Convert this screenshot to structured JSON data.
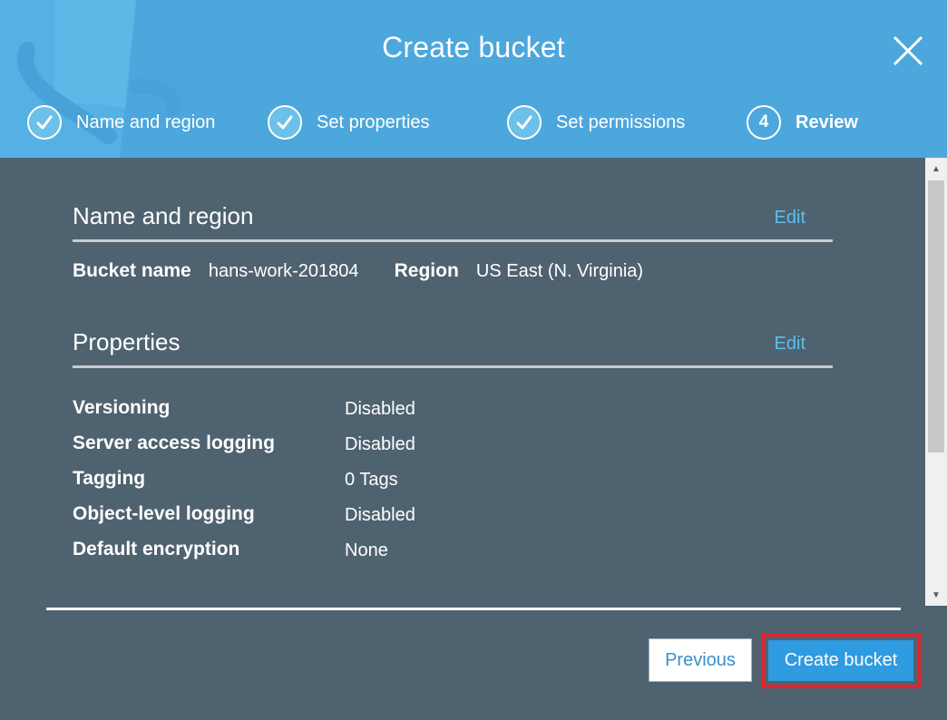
{
  "dialog": {
    "title": "Create bucket"
  },
  "steps": [
    {
      "label": "Name and region",
      "state": "done"
    },
    {
      "label": "Set properties",
      "state": "done"
    },
    {
      "label": "Set permissions",
      "state": "done"
    },
    {
      "label": "Review",
      "state": "current",
      "number": "4"
    }
  ],
  "name_region": {
    "title": "Name and region",
    "edit_label": "Edit",
    "bucket_name_label": "Bucket name",
    "bucket_name_value": "hans-work-201804",
    "region_label": "Region",
    "region_value": "US East (N. Virginia)"
  },
  "properties": {
    "title": "Properties",
    "edit_label": "Edit",
    "rows": [
      {
        "key": "Versioning",
        "value": "Disabled"
      },
      {
        "key": "Server access logging",
        "value": "Disabled"
      },
      {
        "key": "Tagging",
        "value": "0 Tags"
      },
      {
        "key": "Object-level logging",
        "value": "Disabled"
      },
      {
        "key": "Default encryption",
        "value": "None"
      }
    ]
  },
  "footer": {
    "previous_label": "Previous",
    "create_label": "Create bucket"
  },
  "colors": {
    "header": "#4ca7dd",
    "body": "#4f6270",
    "link": "#5bc0ee",
    "primary": "#2f9be0",
    "highlight": "#e8222a"
  },
  "icons": [
    "bucket-logo",
    "close-icon",
    "check-icon",
    "scroll-up-icon",
    "scroll-down-icon"
  ]
}
